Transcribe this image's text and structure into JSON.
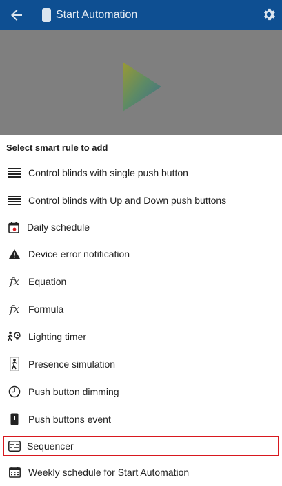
{
  "appbar": {
    "title": "Start Automation",
    "icons": [
      "back-arrow-icon",
      "device-icon",
      "gear-icon"
    ]
  },
  "backdrop": {
    "play_icon": "play-icon"
  },
  "sheet": {
    "title": "Select smart rule to add",
    "items": [
      {
        "label": "Control blinds with single push button",
        "icon": "blinds-icon"
      },
      {
        "label": "Control blinds with Up and Down push buttons",
        "icon": "blinds-icon"
      },
      {
        "label": "Daily schedule",
        "icon": "calendar-icon"
      },
      {
        "label": "Device error notification",
        "icon": "warning-icon"
      },
      {
        "label": "Equation",
        "icon": "fx-icon"
      },
      {
        "label": "Formula",
        "icon": "fx-icon"
      },
      {
        "label": "Lighting timer",
        "icon": "lighting-timer-icon"
      },
      {
        "label": "Presence simulation",
        "icon": "presence-icon"
      },
      {
        "label": "Push button dimming",
        "icon": "dimming-icon"
      },
      {
        "label": "Push buttons event",
        "icon": "push-button-icon"
      },
      {
        "label": "Sequencer",
        "icon": "sequencer-icon",
        "selected": true
      },
      {
        "label": "Weekly schedule for Start Automation",
        "icon": "weekly-calendar-icon"
      }
    ],
    "fx_glyph": "fx"
  },
  "colors": {
    "appbar": "#0e4f92",
    "backdrop": "#7f7f7f",
    "highlight": "#d8181f"
  }
}
